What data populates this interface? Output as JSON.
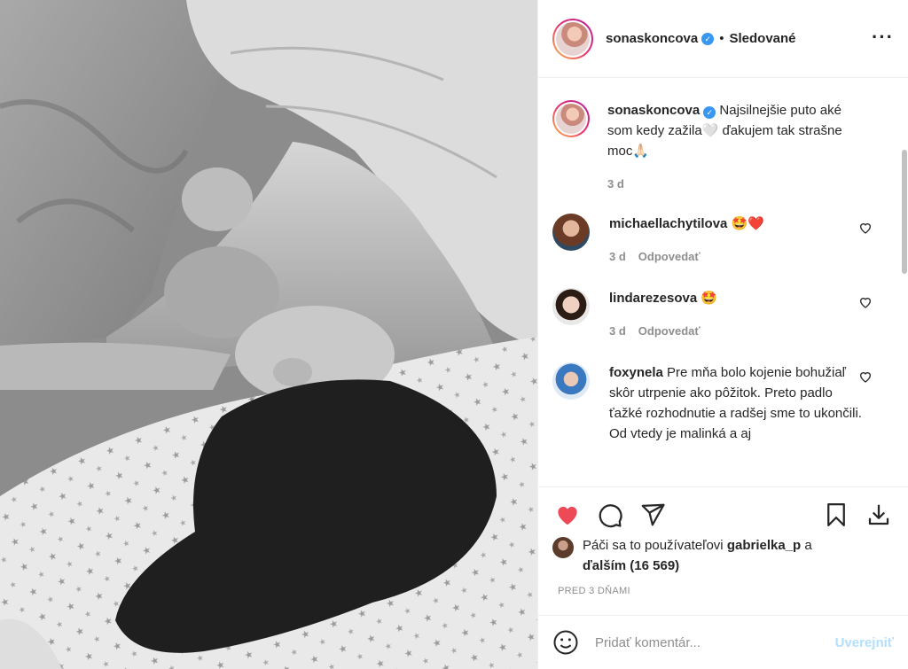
{
  "header": {
    "username": "sonaskoncova",
    "separator": "•",
    "follow_label": "Sledované",
    "more_label": "···"
  },
  "caption": {
    "username": "sonaskoncova",
    "text": "Najsilnejšie puto aké som kedy zažila🤍 ďakujem tak strašne moc🙏🏻",
    "time": "3 d"
  },
  "comments": [
    {
      "username": "michaellachytilova",
      "text": "🤩❤️",
      "time": "3 d",
      "reply_label": "Odpovedať"
    },
    {
      "username": "lindarezesova",
      "text": "🤩",
      "time": "3 d",
      "reply_label": "Odpovedať"
    },
    {
      "username": "foxynela",
      "text": "Pre mňa bolo kojenie bohužiaľ skôr utrpenie ako pôžitok. Preto padlo ťažké rozhodnutie a radšej sme to ukončili. Od vtedy je malinká a aj"
    }
  ],
  "likes": {
    "prefix": "Páči sa to používateľovi",
    "user": "gabrielka_p",
    "joiner": "a",
    "others": "ďalším (16 569)"
  },
  "date": "PRED 3 DŇAMI",
  "add_comment": {
    "placeholder": "Pridať komentár...",
    "post_label": "Uverejniť"
  },
  "colors": {
    "like_red": "#ed4956",
    "link_blue": "#3897f0",
    "post_disabled": "#b2dffc",
    "muted": "#8e8e8e"
  },
  "icons": [
    "heart-icon",
    "comment-icon",
    "share-icon",
    "bookmark-icon",
    "download-icon",
    "smile-icon",
    "verified-icon",
    "more-icon"
  ]
}
